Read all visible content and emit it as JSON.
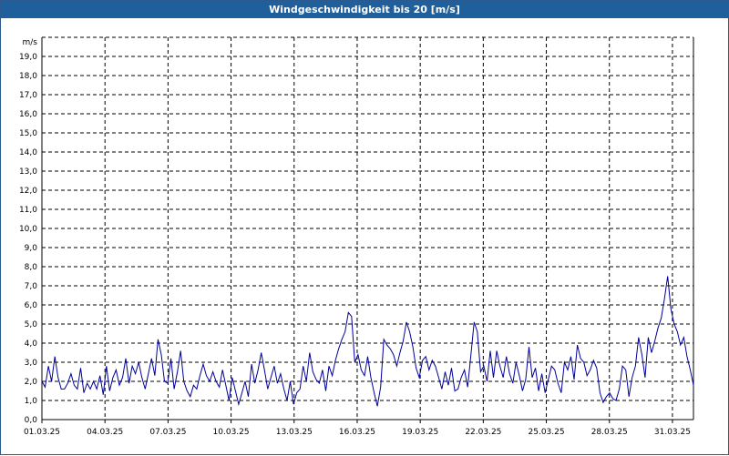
{
  "window": {
    "title": "Windgeschwindigkeit bis 20 [m/s]"
  },
  "colors": {
    "line": "#000099",
    "grid": "#000000",
    "titlebar": "#1f5f9c",
    "border": "#2d5a8e"
  },
  "chart_data": {
    "type": "line",
    "title": "Windgeschwindigkeit bis 20 [m/s]",
    "ylabel": "m/s",
    "xlabel": "",
    "ylim": [
      0,
      20
    ],
    "xlim_days": [
      0,
      31
    ],
    "grid": true,
    "y_ticks": [
      "0,0",
      "1,0",
      "2,0",
      "3,0",
      "4,0",
      "5,0",
      "6,0",
      "7,0",
      "8,0",
      "9,0",
      "10,0",
      "11,0",
      "12,0",
      "13,0",
      "14,0",
      "15,0",
      "16,0",
      "17,0",
      "18,0",
      "19,0"
    ],
    "x_ticks": [
      "01.03.25",
      "04.03.25",
      "07.03.25",
      "10.03.25",
      "13.03.25",
      "16.03.25",
      "19.03.25",
      "22.03.25",
      "25.03.25",
      "28.03.25",
      "31.03.25"
    ],
    "series": [
      {
        "values": [
          2.0,
          1.7,
          2.8,
          2.0,
          3.3,
          2.2,
          1.6,
          1.6,
          1.9,
          2.4,
          1.8,
          1.6,
          2.7,
          1.4,
          1.9,
          1.6,
          2.0,
          1.6,
          2.3,
          1.3,
          2.8,
          1.5,
          2.2,
          2.6,
          1.8,
          2.2,
          3.2,
          1.9,
          2.8,
          2.4,
          3.0,
          2.2,
          1.6,
          2.4,
          3.2,
          2.3,
          4.2,
          3.4,
          2.0,
          1.9,
          3.2,
          1.6,
          2.5,
          3.6,
          2.0,
          1.5,
          1.2,
          1.8,
          1.6,
          2.3,
          2.9,
          2.3,
          2.0,
          2.5,
          2.0,
          1.7,
          2.6,
          1.8,
          1.0,
          2.2,
          1.5,
          0.8,
          1.4,
          2.0,
          1.2,
          2.9,
          1.9,
          2.6,
          3.5,
          2.6,
          1.6,
          2.2,
          2.8,
          1.9,
          2.4,
          1.6,
          1.0,
          2.0,
          0.8,
          1.4,
          1.6,
          2.8,
          2.0,
          3.5,
          2.5,
          2.1,
          1.9,
          2.6,
          1.5,
          2.8,
          2.3,
          3.1,
          3.7,
          4.2,
          4.6,
          5.6,
          5.4,
          3.0,
          3.4,
          2.6,
          2.3,
          3.3,
          2.2,
          1.4,
          0.7,
          1.7,
          4.2,
          3.9,
          3.7,
          3.4,
          2.8,
          3.5,
          4.1,
          5.1,
          4.6,
          3.8,
          2.7,
          2.2,
          3.1,
          3.3,
          2.6,
          3.1,
          2.8,
          2.2,
          1.6,
          2.5,
          1.8,
          2.7,
          1.5,
          1.6,
          2.2,
          2.6,
          1.7,
          3.4,
          5.1,
          4.6,
          2.5,
          2.8,
          2.0,
          3.6,
          2.2,
          3.6,
          2.8,
          2.2,
          3.3,
          2.4,
          1.9,
          3.0,
          2.3,
          1.5,
          2.1,
          3.8,
          2.2,
          2.7,
          1.5,
          2.4,
          1.4,
          2.1,
          2.8,
          2.6,
          1.9,
          1.4,
          3.0,
          2.6,
          3.3,
          2.1,
          3.9,
          3.2,
          3.0,
          2.3,
          2.6,
          3.1,
          2.7,
          1.4,
          0.9,
          1.2,
          1.4,
          1.1,
          1.0,
          1.6,
          2.8,
          2.6,
          1.2,
          2.2,
          2.8,
          4.3,
          3.4,
          2.2,
          4.3,
          3.5,
          4.1,
          4.8,
          5.3,
          6.3,
          7.5,
          5.8,
          5.0,
          4.6,
          3.9,
          4.3,
          3.3,
          2.6,
          1.8
        ]
      }
    ]
  }
}
